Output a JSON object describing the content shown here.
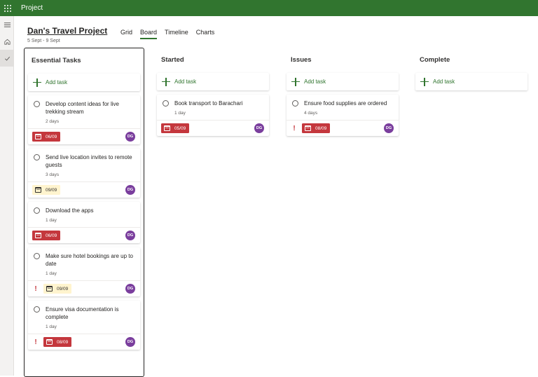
{
  "app": {
    "title": "Project"
  },
  "project": {
    "name": "Dan's Travel Project",
    "dates": "5 Sept - 9 Sept"
  },
  "views": [
    "Grid",
    "Board",
    "Timeline",
    "Charts"
  ],
  "active_view": "Board",
  "add_task_label": "Add task",
  "assignee_initials": "DG",
  "colors": {
    "accent": "#31752f",
    "late": "#c4373d",
    "soon": "#fff4ce",
    "avatar": "#7a3e9d"
  },
  "columns": {
    "essential": {
      "title": "Essential Tasks",
      "tasks": [
        {
          "title": "Develop content ideas for live trekking stream",
          "duration": "2 days",
          "due": "06/09",
          "due_status": "late",
          "urgent": false
        },
        {
          "title": "Send live location invites to remote guests",
          "duration": "3 days",
          "due": "09/09",
          "due_status": "soon",
          "urgent": false
        },
        {
          "title": "Download the apps",
          "duration": "1 day",
          "due": "06/09",
          "due_status": "late",
          "urgent": false
        },
        {
          "title": "Make sure hotel bookings are up to date",
          "duration": "1 day",
          "due": "09/09",
          "due_status": "soon",
          "urgent": true
        },
        {
          "title": "Ensure visa documentation is complete",
          "duration": "1 day",
          "due": "08/09",
          "due_status": "late",
          "urgent": true
        }
      ]
    },
    "started": {
      "title": "Started",
      "tasks": [
        {
          "title": "Book transport to Barachari",
          "duration": "1 day",
          "due": "05/09",
          "due_status": "late",
          "urgent": false
        }
      ]
    },
    "issues": {
      "title": "Issues",
      "tasks": [
        {
          "title": "Ensure food supplies are ordered",
          "duration": "4 days",
          "due": "08/09",
          "due_status": "late",
          "urgent": true
        }
      ]
    },
    "complete": {
      "title": "Complete",
      "tasks": []
    }
  }
}
